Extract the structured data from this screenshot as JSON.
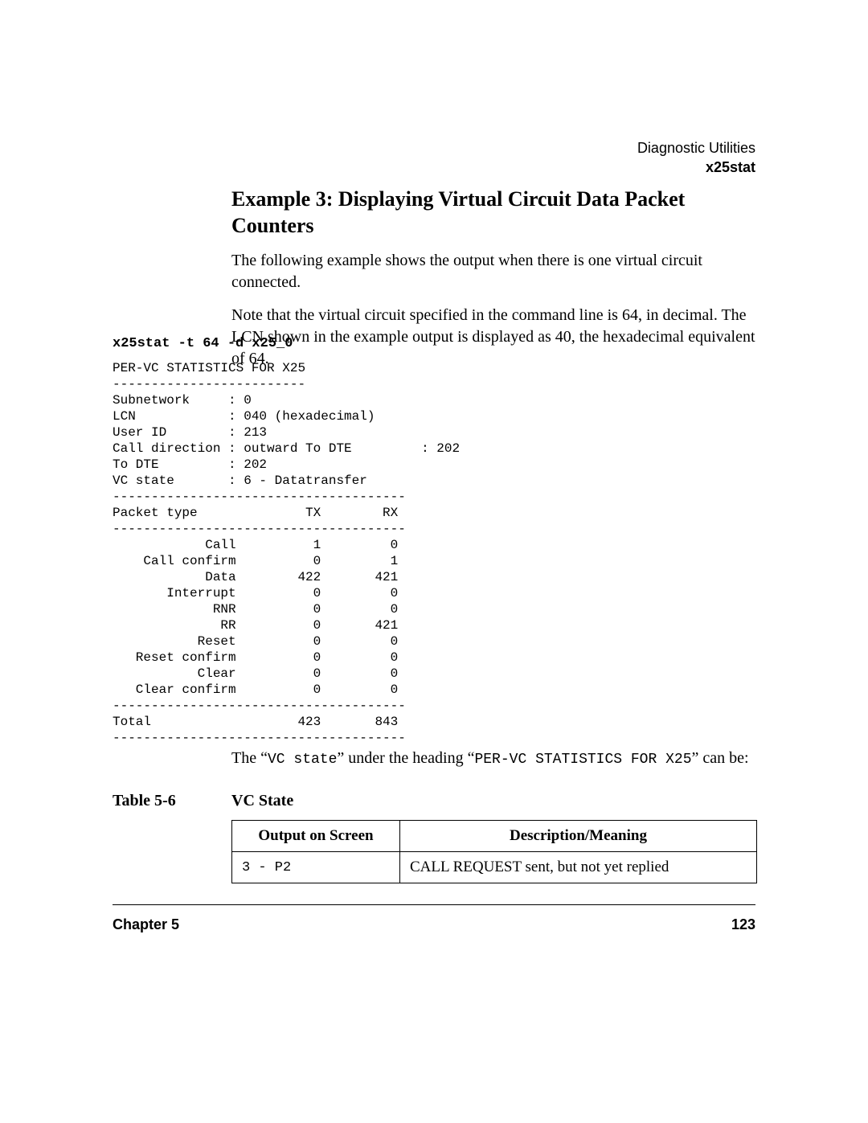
{
  "running_head": {
    "line1": "Diagnostic Utilities",
    "line2": "x25stat"
  },
  "section": {
    "title": "Example 3: Displaying Virtual Circuit Data Packet Counters",
    "para1": "The following example shows the output when there is one virtual circuit connected.",
    "para2": "Note that the virtual circuit specified in the command line is 64, in decimal. The LCN shown in the example output is displayed as 40, the hexadecimal equivalent of 64."
  },
  "command": "x25stat -t 64 -d x25_0",
  "console": "PER-VC STATISTICS FOR X25\n-------------------------\nSubnetwork     : 0\nLCN            : 040 (hexadecimal)\nUser ID        : 213\nCall direction : outward To DTE         : 202\nTo DTE         : 202\nVC state       : 6 - Datatransfer\n--------------------------------------\nPacket type              TX        RX\n--------------------------------------\n            Call          1         0\n    Call confirm          0         1\n            Data        422       421\n       Interrupt          0         0\n             RNR          0         0\n              RR          0       421\n           Reset          0         0\n   Reset confirm          0         0\n           Clear          0         0\n   Clear confirm          0         0\n--------------------------------------\nTotal                   423       843\n--------------------------------------",
  "post_console": {
    "pre1": "The “",
    "mono1": "VC state",
    "mid1": "” under the heading “",
    "mono2": "PER-VC STATISTICS FOR X25",
    "post1": "” can be:"
  },
  "table": {
    "label": "Table 5-6",
    "caption": "VC State",
    "headers": {
      "col1": "Output on Screen",
      "col2": "Description/Meaning"
    },
    "row1": {
      "code": "3 - P2",
      "desc": "CALL REQUEST sent, but not yet replied"
    }
  },
  "footer": {
    "left": "Chapter 5",
    "right": "123"
  }
}
